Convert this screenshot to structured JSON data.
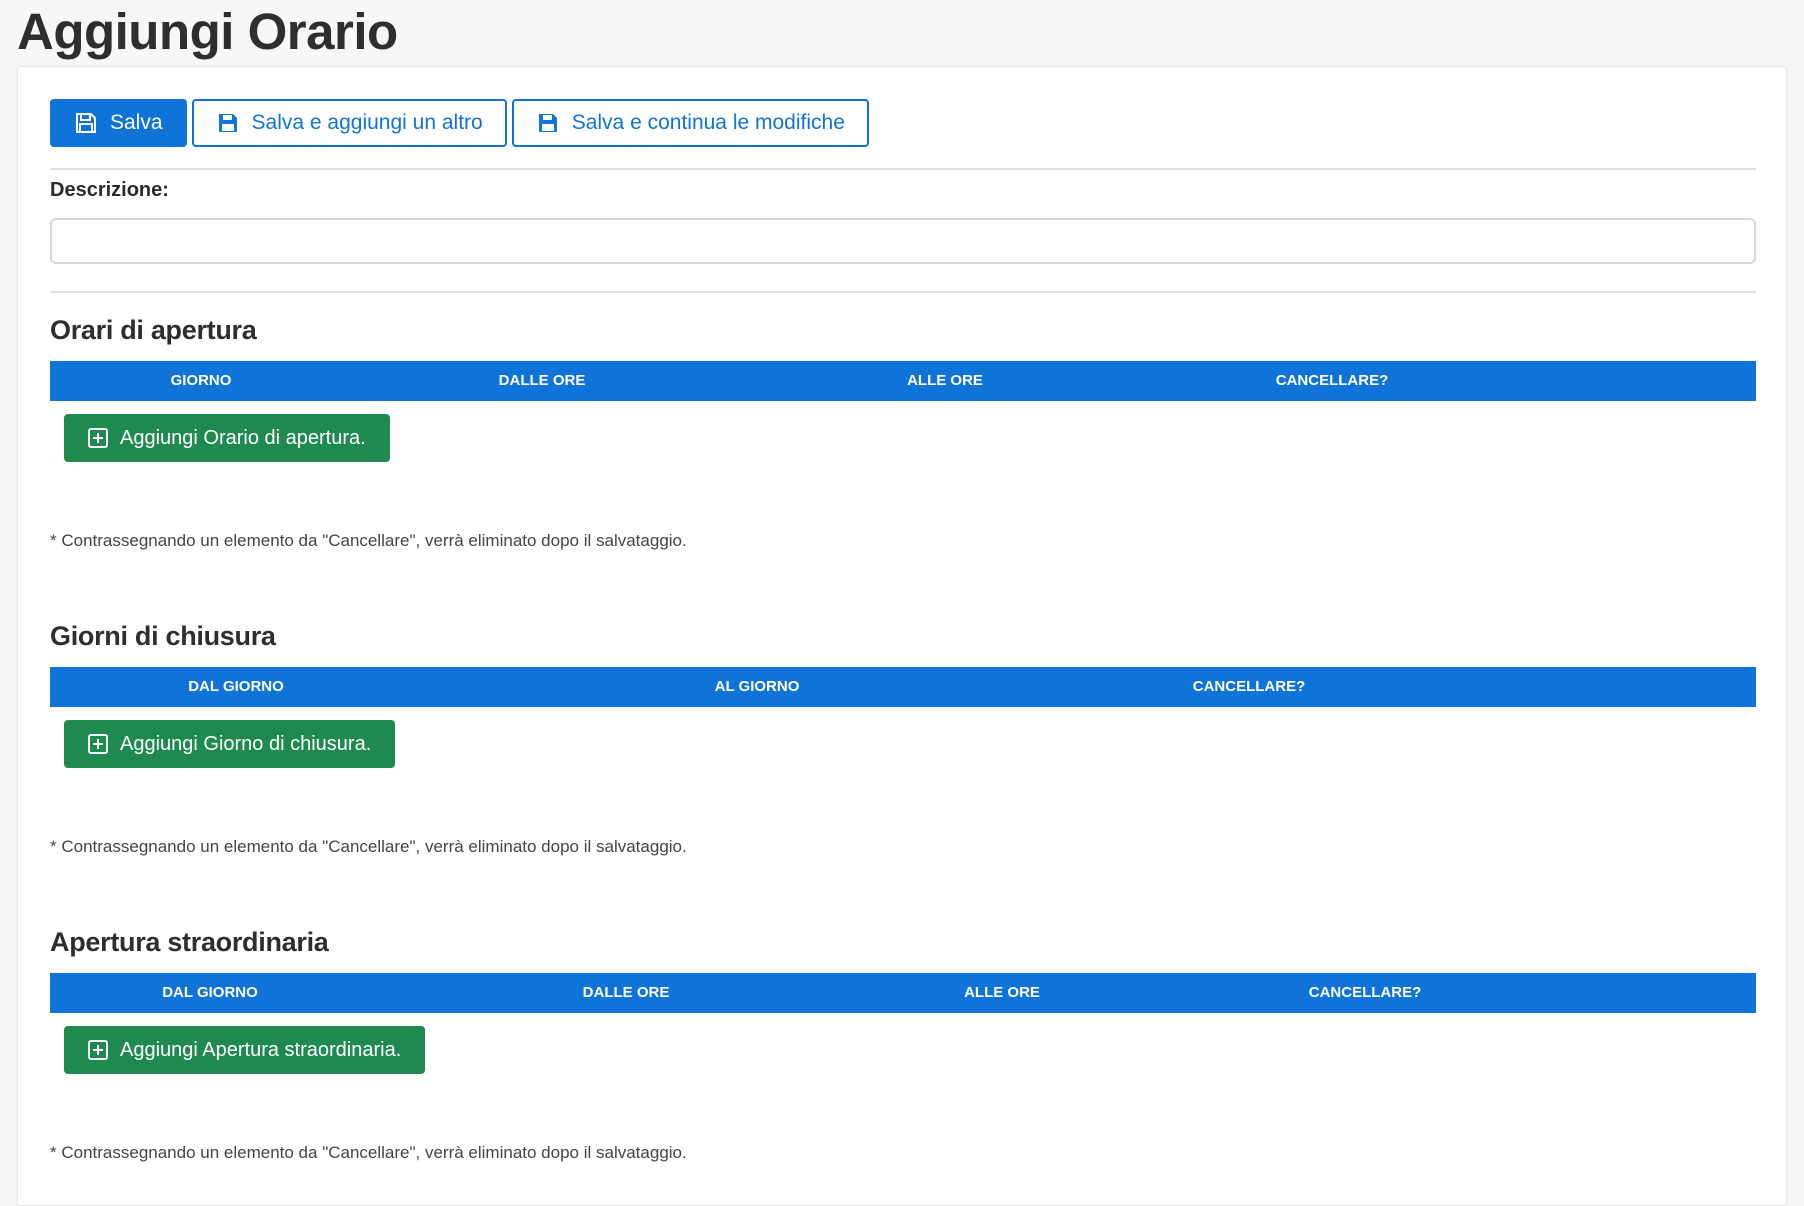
{
  "page": {
    "title": "Aggiungi Orario"
  },
  "toolbar": {
    "save_label": "Salva",
    "save_add_label": "Salva e aggiungi un altro",
    "save_continue_label": "Salva e continua le modifiche"
  },
  "form": {
    "description_label": "Descrizione:",
    "description_value": "",
    "description_placeholder": ""
  },
  "sections": [
    {
      "title": "Orari di apertura",
      "columns": [
        "GIORNO",
        "DALLE ORE",
        "ALLE ORE",
        "CANCELLARE?"
      ],
      "add_label": "Aggiungi Orario di apertura.",
      "note": "* Contrassegnando un elemento da \"Cancellare\", verrà eliminato dopo il salvataggio."
    },
    {
      "title": "Giorni di chiusura",
      "columns": [
        "DAL GIORNO",
        "AL GIORNO",
        "CANCELLARE?"
      ],
      "add_label": "Aggiungi Giorno di chiusura.",
      "note": "* Contrassegnando un elemento da \"Cancellare\", verrà eliminato dopo il salvataggio."
    },
    {
      "title": "Apertura straordinaria",
      "columns": [
        "DAL GIORNO",
        "DALLE ORE",
        "ALLE ORE",
        "CANCELLARE?"
      ],
      "add_label": "Aggiungi Apertura straordinaria.",
      "note": "* Contrassegnando un elemento da \"Cancellare\", verrà eliminato dopo il salvataggio."
    }
  ],
  "icons": {
    "save": "floppy-disk-icon",
    "add": "plus-square-icon"
  },
  "colors": {
    "primary": "#0f73d8",
    "success": "#1f8a4f",
    "background": "#f6f7f9"
  }
}
